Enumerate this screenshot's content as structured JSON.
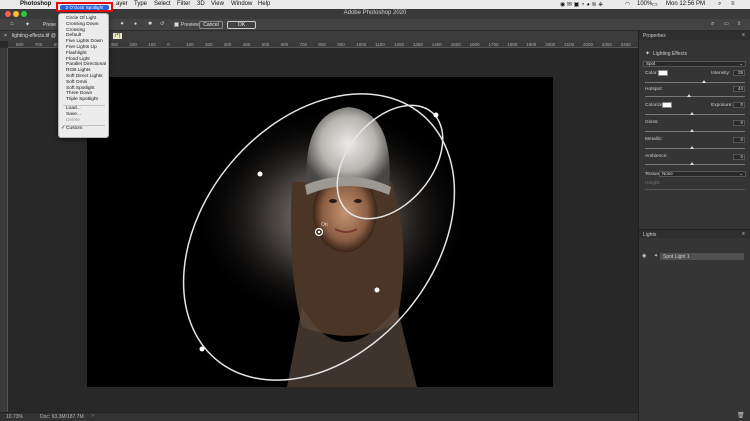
{
  "menubar": {
    "app": "Photoshop",
    "items": [
      "ayer",
      "Type",
      "Select",
      "Filter",
      "3D",
      "View",
      "Window",
      "Help"
    ],
    "battery": "100%",
    "clock": "Mon 12:56 PM"
  },
  "titlebar": {
    "title": "Adobe Photoshop 2020"
  },
  "options": {
    "presets_label": "Prese",
    "preview_label": "Preview",
    "cancel_label": "Cancel",
    "ok_label": "OK"
  },
  "doc": {
    "tab_label": "lighting-effects.tif @",
    "tab_suffix": "r*)"
  },
  "ruler": {
    "ticks": [
      "800",
      "700",
      "600",
      "500",
      "400",
      "300",
      "200",
      "100",
      "0",
      "100",
      "200",
      "300",
      "400",
      "500",
      "600",
      "700",
      "800",
      "900",
      "1000",
      "1100",
      "1200",
      "1300",
      "1400",
      "1500",
      "1600",
      "1700",
      "1800",
      "1900",
      "2000",
      "2100",
      "2200",
      "2300",
      "2400",
      "2500",
      "2600",
      "2700",
      "2800",
      "2900",
      "3000",
      "3100",
      "3200",
      "3300",
      "3400",
      "3500",
      "3600",
      "3700",
      "3800",
      "3900",
      "4000",
      "4100",
      "4200",
      "4300",
      "4400",
      "4500",
      "4600",
      "4700",
      "4800",
      "4900",
      "5000",
      "5100",
      "5200",
      "5300",
      "5400",
      "5500",
      "5600",
      "5700",
      "5800",
      "5900",
      "6000",
      "6100",
      "6200",
      "6300"
    ]
  },
  "canvas": {
    "handle_label": "On"
  },
  "status": {
    "zoom": "10.73%",
    "doc_info": "Doc: 93.3M/187.7M"
  },
  "dropdown": {
    "selected": "2 O'clock Spotlight",
    "items": [
      "Circle Of Light",
      "Crossing Down",
      "Crossing",
      "Default",
      "Five Lights Down",
      "Five Lights Up",
      "Flashlight",
      "Flood Light",
      "Parallel Directional",
      "RGB Lights",
      "Soft Direct Lights",
      "Soft Omni",
      "Soft Spotlight",
      "Three Down",
      "Triple Spotlight"
    ],
    "actions": [
      "Load...",
      "Save...",
      "Delete"
    ],
    "custom": "Custom"
  },
  "properties": {
    "panel_title": "Properties",
    "effect_title": "Lighting Effects",
    "light_type": "Spot",
    "color_label": "Color:",
    "intensity_label": "Intensity:",
    "intensity": "25",
    "hotspot_label": "Hotspot:",
    "hotspot": "44",
    "colorize_label": "Colorize:",
    "exposure_label": "Exposure:",
    "exposure": "0",
    "gloss_label": "Gloss:",
    "gloss": "0",
    "metallic_label": "Metallic:",
    "metallic": "0",
    "ambience_label": "Ambience:",
    "ambience": "0",
    "texture_label": "Texture:",
    "texture": "None",
    "height_label": "Height:"
  },
  "lights": {
    "panel_title": "Lights",
    "light_name": "Spot Light 1"
  },
  "colors": {
    "accent": "#2a61d3",
    "highlight_border": "#e01010"
  }
}
